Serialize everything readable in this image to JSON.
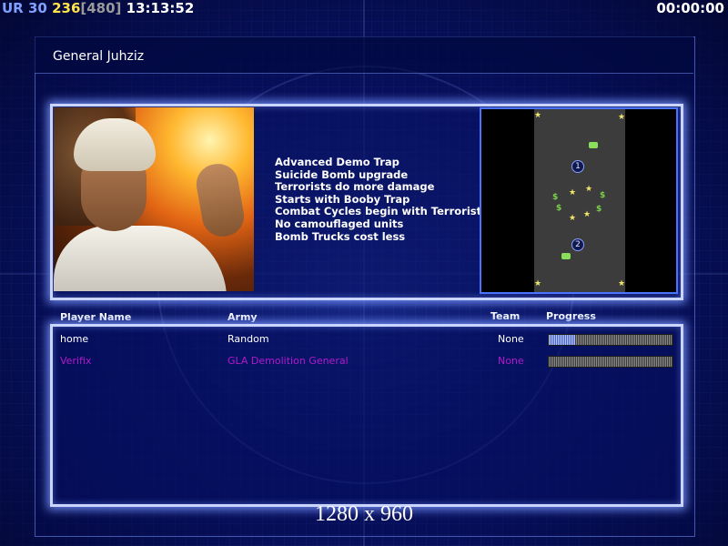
{
  "hud": {
    "ur_label": "UR",
    "ur_value": "30",
    "money": "236",
    "money_cap": "[480]",
    "clock": "13:13:52",
    "timer": "00:00:00"
  },
  "general": {
    "name": "General Juhziz",
    "traits": [
      "Advanced Demo Trap",
      "Suicide Bomb upgrade",
      "Terrorists do more damage",
      "Starts with Booby Trap",
      "Combat Cycles begin with Terrorist",
      "No camouflaged units",
      "Bomb Trucks cost less"
    ]
  },
  "minimap": {
    "start_positions": [
      "1",
      "2"
    ]
  },
  "table": {
    "headers": {
      "player_name": "Player Name",
      "army": "Army",
      "team": "Team",
      "progress": "Progress"
    },
    "rows": [
      {
        "player_name": "home",
        "army": "Random",
        "team": "None",
        "progress": 0.21,
        "color": "#ffffff"
      },
      {
        "player_name": "Verifix",
        "army": "GLA Demolition General",
        "team": "None",
        "progress": 0.0,
        "color": "#b21ac8"
      }
    ]
  },
  "resolution": "1280 x 960",
  "colors": {
    "frame_glow": "#c9d4ff",
    "money": "#ffe34a",
    "ur": "#7fa0ff",
    "player2": "#b21ac8",
    "minimap_border": "#4a74ff"
  }
}
